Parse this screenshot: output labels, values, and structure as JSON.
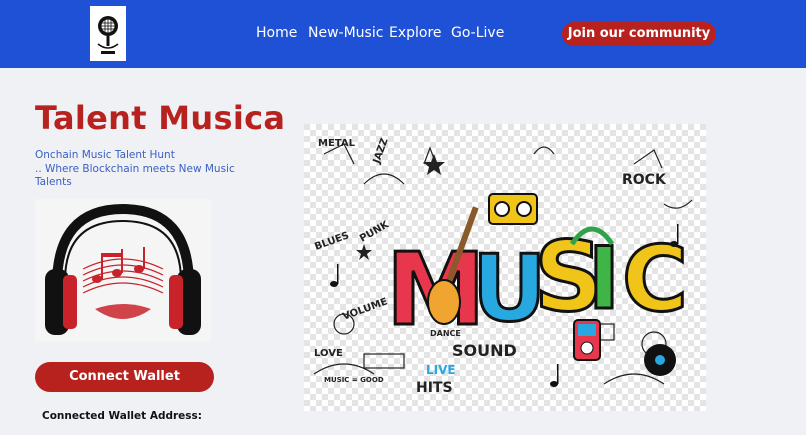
{
  "nav": {
    "logo": "microphone-logo",
    "links": [
      "Home",
      "New-Music",
      "Explore",
      "Go-Live"
    ],
    "cta": "Join our community"
  },
  "hero": {
    "title": "Talent Musica",
    "subtitle_lines": [
      "Onchain Music Talent Hunt",
      ".. Where Blockchain meets New Music",
      "Talents"
    ],
    "connect_label": "Connect Wallet",
    "wallet_label": "Connected Wallet Address:"
  },
  "illustration": {
    "letters": [
      "M",
      "U",
      "S",
      "I",
      "C"
    ],
    "words": [
      "METAL",
      "JAZZ",
      "ROCK",
      "BLUES",
      "PUNK",
      "VOLUME",
      "DANCE",
      "SOUND",
      "LOVE",
      "LIVE",
      "HITS",
      "MUSIC = GOOD"
    ]
  },
  "colors": {
    "nav_bg": "#1f51d6",
    "accent_red": "#b8221e",
    "subtitle_blue": "#3a5fc4",
    "page_bg": "#f0f1f4"
  }
}
